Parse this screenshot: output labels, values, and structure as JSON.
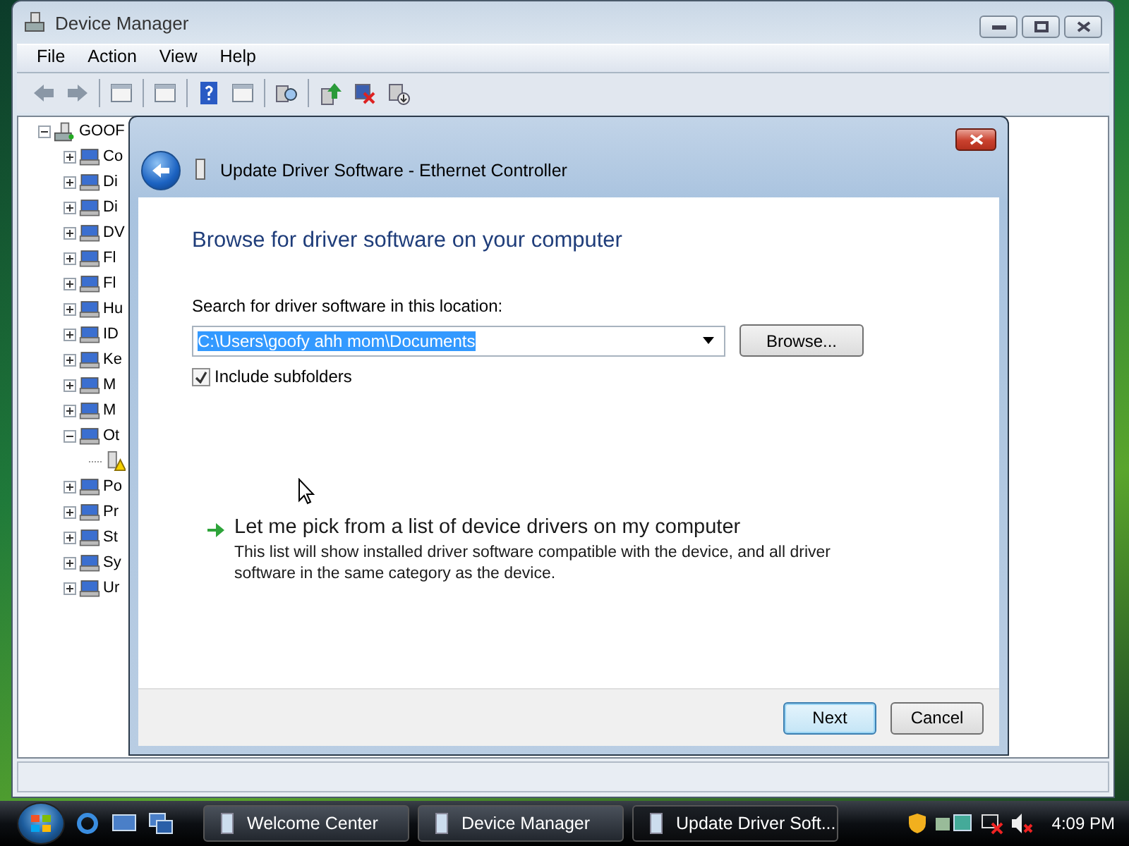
{
  "device_manager": {
    "title": "Device Manager",
    "menu": [
      "File",
      "Action",
      "View",
      "Help"
    ],
    "tree": {
      "label": "GOOF",
      "kind": "computer",
      "expanded": true,
      "children": [
        {
          "label": "Co",
          "kind": "category",
          "expanded": false
        },
        {
          "label": "Di",
          "kind": "category",
          "expanded": false
        },
        {
          "label": "Di",
          "kind": "category",
          "expanded": false
        },
        {
          "label": "DV",
          "kind": "category",
          "expanded": false
        },
        {
          "label": "Fl",
          "kind": "category",
          "expanded": false
        },
        {
          "label": "Fl",
          "kind": "category",
          "expanded": false
        },
        {
          "label": "Hu",
          "kind": "category",
          "expanded": false
        },
        {
          "label": "ID",
          "kind": "category",
          "expanded": false
        },
        {
          "label": "Ke",
          "kind": "category",
          "expanded": false
        },
        {
          "label": "M",
          "kind": "category",
          "expanded": false
        },
        {
          "label": "M",
          "kind": "category",
          "expanded": false
        },
        {
          "label": "Ot",
          "kind": "category",
          "expanded": true,
          "children": [
            {
              "kind": "warning-device"
            }
          ]
        },
        {
          "label": "Po",
          "kind": "category",
          "expanded": false
        },
        {
          "label": "Pr",
          "kind": "category",
          "expanded": false
        },
        {
          "label": "St",
          "kind": "category",
          "expanded": false
        },
        {
          "label": "Sy",
          "kind": "category",
          "expanded": false
        },
        {
          "label": "Ur",
          "kind": "category",
          "expanded": false
        }
      ]
    }
  },
  "dialog": {
    "title": "Update Driver Software - Ethernet Controller",
    "heading": "Browse for driver software on your computer",
    "location_label": "Search for driver software in this location:",
    "location_value": "C:\\Users\\goofy ahh mom\\Documents",
    "location_selected": true,
    "browse_button": "Browse...",
    "include_subfolders": {
      "label": "Include subfolders",
      "checked": true
    },
    "pick_option": {
      "title": "Let me pick from a list of device drivers on my computer",
      "description": "This list will show installed driver software compatible with the device, and all driver software in the same category as the device."
    },
    "buttons": [
      {
        "label": "Next",
        "default": true
      },
      {
        "label": "Cancel",
        "default": false
      }
    ]
  },
  "taskbar": {
    "tasks": [
      {
        "label": "Welcome Center",
        "selected": false
      },
      {
        "label": "Device Manager",
        "selected": false
      },
      {
        "label": "Update Driver Soft...",
        "selected": true
      }
    ],
    "clock": "4:09 PM"
  }
}
